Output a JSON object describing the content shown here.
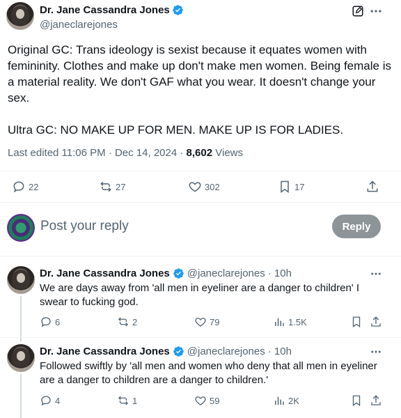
{
  "colors": {
    "accent": "#1d9bf0",
    "muted": "#536471",
    "text": "#0f1419",
    "reply_button_bg": "#8d9599"
  },
  "main_tweet": {
    "author_name": "Dr. Jane Cassandra Jones",
    "handle": "@janeclarejones",
    "text": "Original GC: Trans ideology is sexist because it equates women with femininity. Clothes and make up don't make men women. Being female is a material reality. We don't GAF what you wear. It doesn't change your sex.\n\nUltra GC: NO MAKE UP FOR MEN. MAKE UP IS FOR LADIES.",
    "edited_label": "Last edited 11:06 PM · Dec 14, 2024 · ",
    "views_count": "8,602",
    "views_label": " Views",
    "replies": "22",
    "reposts": "27",
    "likes": "302",
    "bookmarks": "17"
  },
  "composer": {
    "placeholder": "Post your reply",
    "button_label": "Reply"
  },
  "replies": [
    {
      "author_name": "Dr. Jane Cassandra Jones",
      "handle": "@janeclarejones",
      "time": "· 10h",
      "text": "We are days away from 'all men in eyeliner are a danger to children' I swear to fucking god.",
      "replies": "6",
      "reposts": "2",
      "likes": "79",
      "views": "1.5K"
    },
    {
      "author_name": "Dr. Jane Cassandra Jones",
      "handle": "@janeclarejones",
      "time": "· 10h",
      "text": "Followed swiftly by 'all men and women who deny that all men in eyeliner are a danger to children are a danger to children.'",
      "replies": "4",
      "reposts": "1",
      "likes": "59",
      "views": "2K"
    }
  ]
}
